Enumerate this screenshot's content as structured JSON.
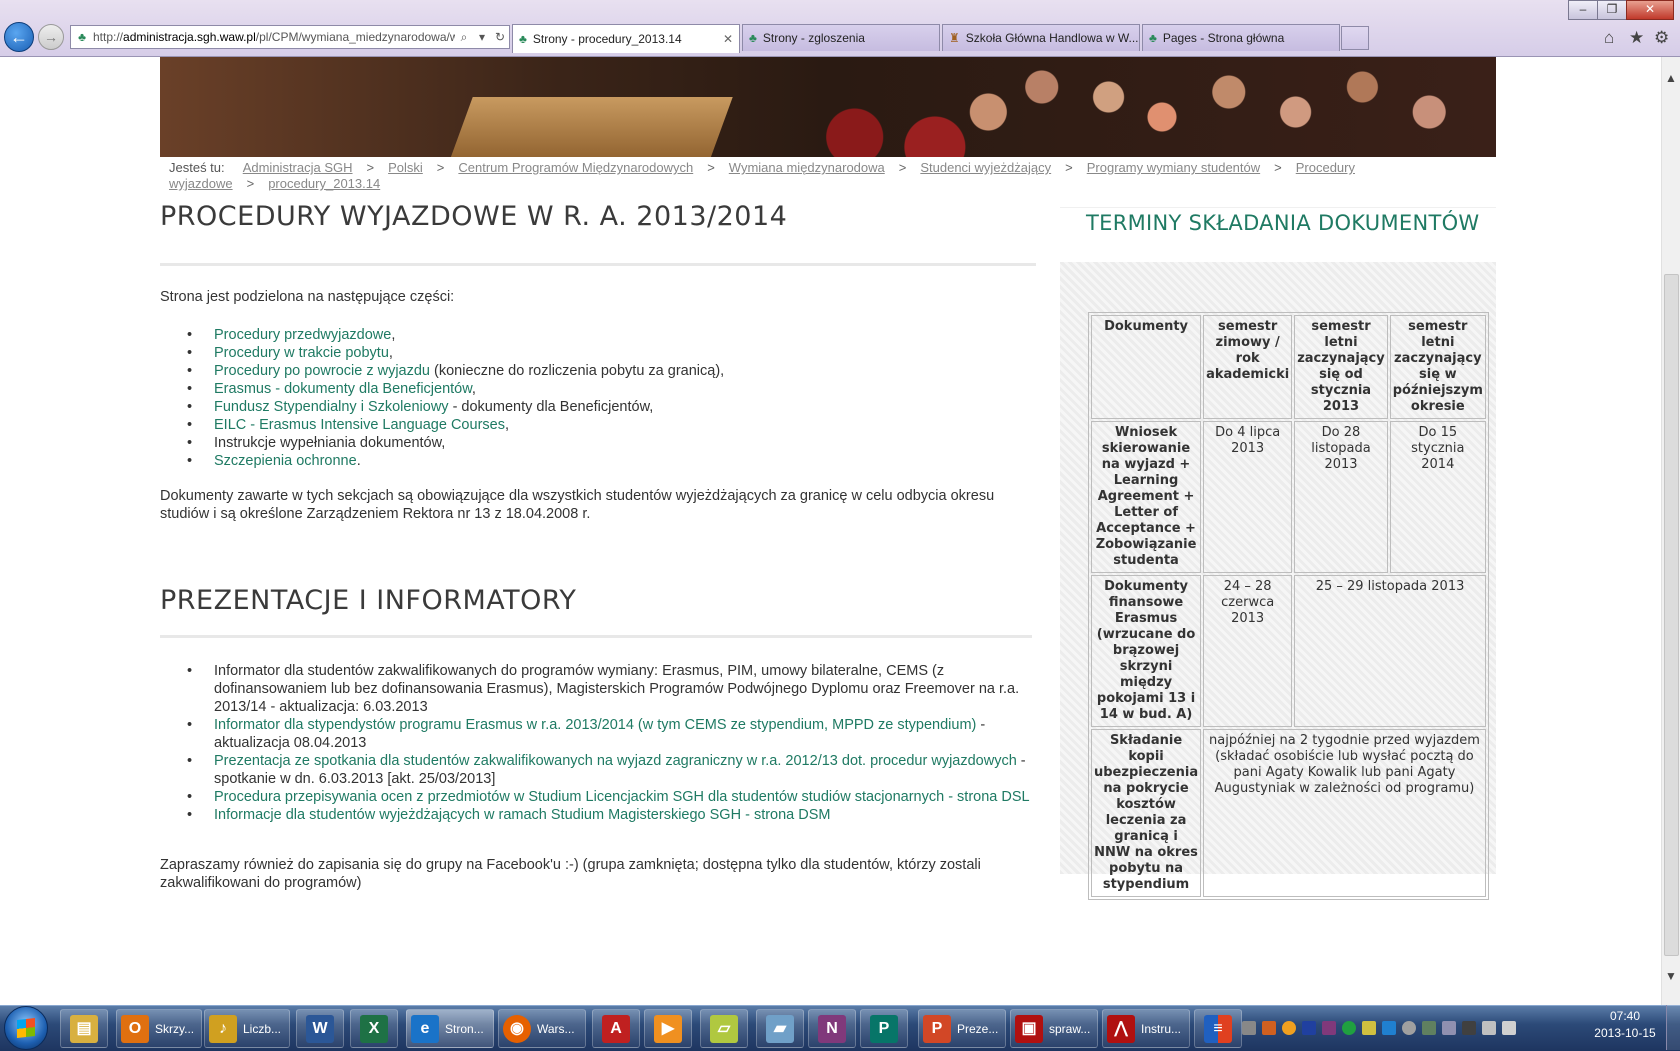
{
  "browser": {
    "address_bar": {
      "url_prefix": "http://",
      "url_domain": "administracja.sgh.waw.pl",
      "url_path": "/pl/CPM/wymiana_miedzynarodowa/wyj"
    },
    "tabs": [
      {
        "label": "Strony - procedury_2013.14",
        "active": true,
        "close": "✕"
      },
      {
        "label": "Strony - zgloszenia",
        "active": false
      },
      {
        "label": "Szkoła Główna Handlowa w W...",
        "active": false
      },
      {
        "label": "Pages - Strona główna",
        "active": false
      }
    ]
  },
  "breadcrumb": {
    "prefix": "Jesteś tu:",
    "sep": ">",
    "items": [
      "Administracja SGH",
      "Polski",
      "Centrum Programów Międzynarodowych",
      "Wymiana międzynarodowa",
      "Studenci wyjeżdżający",
      "Programy wymiany studentów",
      "Procedury wyjazdowe",
      "procedury_2013.14"
    ]
  },
  "main": {
    "title": "PROCEDURY WYJAZDOWE W R. A. 2013/2014",
    "intro": "Strona jest podzielona na następujące części:",
    "sections": [
      {
        "link": "Procedury przedwyjazdowe",
        "rest": ","
      },
      {
        "link": "Procedury w trakcie pobytu",
        "rest": ","
      },
      {
        "link": "Procedury po powrocie z wyjazdu",
        "rest": " (konieczne do rozliczenia pobytu za granicą),"
      },
      {
        "link": "Erasmus - dokumenty dla Beneficjentów",
        "rest": ","
      },
      {
        "link": "Fundusz Stypendialny i Szkoleniowy",
        "rest": " - dokumenty dla Beneficjentów,"
      },
      {
        "link": "EILC - Erasmus Intensive Language Courses",
        "rest": ","
      },
      {
        "link": "",
        "rest": "Instrukcje wypełniania dokumentów,"
      },
      {
        "link": "Szczepienia ochronne",
        "rest": "."
      }
    ],
    "paragraph": "Dokumenty zawarte w tych sekcjach są obowiązujące dla wszystkich studentów wyjeżdżających za granicę w celu odbycia okresu studiów i są określone Zarządzeniem Rektora nr 13 z 18.04.2008 r."
  },
  "presentations": {
    "title": "PREZENTACJE I INFORMATORY",
    "items": [
      {
        "link": "",
        "rest": "Informator dla studentów zakwalifikowanych do programów wymiany: Erasmus, PIM, umowy bilateralne, CEMS (z dofinansowaniem lub bez dofinansowania Erasmus), Magisterskich Programów Podwójnego Dyplomu oraz Freemover na r.a. 2013/14 - aktualizacja: 6.03.2013"
      },
      {
        "link": "Informator dla stypendystów programu Erasmus w r.a. 2013/2014 (w tym CEMS ze stypendium, MPPD ze stypendium)",
        "rest": " - aktualizacja 08.04.2013"
      },
      {
        "link": "Prezentacja ze spotkania dla studentów zakwalifikowanych na wyjazd zagraniczny w r.a. 2012/13 dot. procedur wyjazdowych",
        "rest": " - spotkanie w dn. 6.03.2013 [akt. 25/03/2013]"
      },
      {
        "link": "Procedura przepisywania ocen z przedmiotów w Studium Licencjackim SGH dla studentów studiów stacjonarnych - strona DSL",
        "rest": ""
      },
      {
        "link": "Informacje dla studentów wyjeżdżających w ramach Studium Magisterskiego SGH - strona DSM",
        "rest": ""
      }
    ],
    "footer": "Zapraszamy również do zapisania się do grupy na Facebook'u :-) (grupa zamknięta; dostępna tylko dla studentów, którzy zostali zakwalifikowani do programów)"
  },
  "sidebar": {
    "title": "TERMINY SKŁADANIA DOKUMENTÓW",
    "table": {
      "headers": [
        "Dokumenty",
        "semestr zimowy / rok akademicki",
        "semestr letni zaczynający się od stycznia 2013",
        "semestr letni zaczynający się w późniejszym okresie"
      ],
      "row1": {
        "label": "Wniosek skierowanie na wyjazd + Learning Agreement + Letter of Acceptance + Zobowiązanie studenta",
        "c1": "Do 4 lipca 2013",
        "c2": "Do 28 listopada 2013",
        "c3": "Do 15 stycznia 2014"
      },
      "row2": {
        "label": "Dokumenty finansowe Erasmus (wrzucane do brązowej skrzyni między pokojami 13 i 14 w bud. A)",
        "c1": "24 – 28 czerwca 2013",
        "c23": "25 – 29 listopada 2013"
      },
      "row3": {
        "label": "Składanie kopii ubezpieczenia na pokrycie kosztów leczenia za granicą i NNW na okres pobytu na stypendium",
        "c123": "najpóźniej na 2 tygodnie przed wyjazdem (składać osobiście lub wysłać pocztą do pani Agaty Kowalik lub pani Agaty Augustyniak w zależności od programu)"
      }
    }
  },
  "taskbar": {
    "items": [
      {
        "label": "Skrzy...",
        "icon": "outlook-icon",
        "color": "#e07010"
      },
      {
        "label": "Liczb...",
        "icon": "alarm-icon",
        "color": "#d0a020"
      },
      {
        "label": "",
        "icon": "word-icon",
        "color": "#2b5797"
      },
      {
        "label": "",
        "icon": "excel-icon",
        "color": "#1e7145"
      },
      {
        "label": "Stron...",
        "icon": "ie-icon",
        "color": "#1a73c8"
      },
      {
        "label": "Wars...",
        "icon": "firefox-icon",
        "color": "#e66000"
      },
      {
        "label": "",
        "icon": "app-icon",
        "color": "#c02020"
      },
      {
        "label": "",
        "icon": "media-icon",
        "color": "#f09020"
      },
      {
        "label": "",
        "icon": "folder-icon",
        "color": "#b0c840"
      },
      {
        "label": "",
        "icon": "notes-icon",
        "color": "#70a0c8"
      },
      {
        "label": "",
        "icon": "onenote-icon",
        "color": "#80397b"
      },
      {
        "label": "",
        "icon": "publisher-icon",
        "color": "#077568"
      },
      {
        "label": "Preze...",
        "icon": "powerpoint-icon",
        "color": "#d24726"
      },
      {
        "label": "spraw...",
        "icon": "pdf-icon",
        "color": "#b01010"
      },
      {
        "label": "Instru...",
        "icon": "acrobat-icon",
        "color": "#b01010"
      }
    ],
    "clock_time": "07:40",
    "clock_date": "2013-10-15"
  }
}
